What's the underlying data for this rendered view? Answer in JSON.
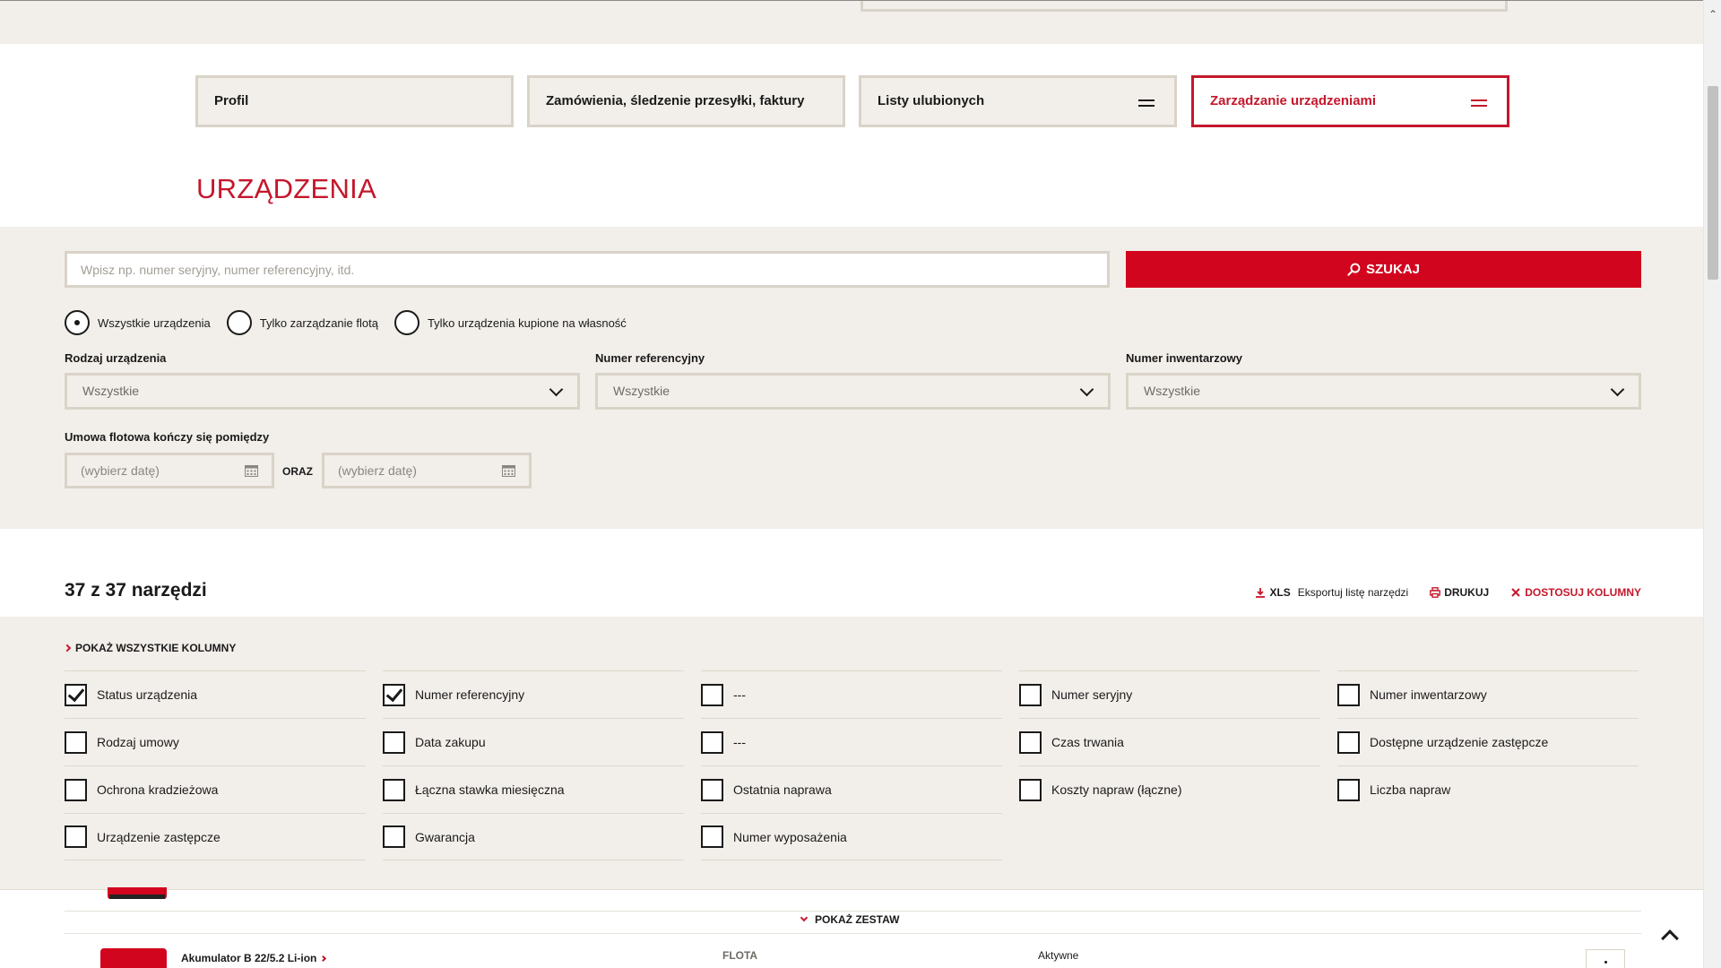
{
  "nav": {
    "tabs": [
      {
        "label": "Profil"
      },
      {
        "label": "Zamówienia, śledzenie przesyłki, faktury"
      },
      {
        "label": "Listy ulubionych"
      },
      {
        "label": "Zarządzanie urządzeniami"
      }
    ],
    "active_index": 3
  },
  "page_title": "URZĄDZENIA",
  "search": {
    "placeholder": "Wpisz np. numer seryjny, numer referencyjny, itd.",
    "value": "",
    "button_label": "SZUKAJ"
  },
  "radio_options": [
    {
      "label": "Wszystkie urządzenia",
      "checked": true
    },
    {
      "label": "Tylko zarządzanie flotą",
      "checked": false
    },
    {
      "label": "Tylko urządzenia kupione na własność",
      "checked": false
    }
  ],
  "filters": {
    "device_type": {
      "label": "Rodzaj urządzenia",
      "value": "Wszystkie"
    },
    "reference_number": {
      "label": "Numer referencyjny",
      "value": "Wszystkie"
    },
    "inventory_number": {
      "label": "Numer inwentarzowy",
      "value": "Wszystkie"
    }
  },
  "date_range": {
    "label": "Umowa flotowa kończy się pomiędzy",
    "from_placeholder": "(wybierz datę)",
    "joiner": "ORAZ",
    "to_placeholder": "(wybierz datę)"
  },
  "results": {
    "count_text": "37 z 37 narzędzi"
  },
  "toolbar": {
    "xls_label": "XLS",
    "export_label": "Eksportuj listę narzędzi",
    "print_label": "DRUKUJ",
    "customize_label": "DOSTOSUJ KOLUMNY"
  },
  "columns_panel": {
    "show_all_label": "POKAŻ WSZYSTKIE KOLUMNY",
    "items": [
      {
        "label": "Status urządzenia",
        "checked": true
      },
      {
        "label": "Numer referencyjny",
        "checked": true
      },
      {
        "label": "---",
        "checked": false
      },
      {
        "label": "Numer seryjny",
        "checked": false
      },
      {
        "label": "Numer inwentarzowy",
        "checked": false
      },
      {
        "label": "Rodzaj umowy",
        "checked": false
      },
      {
        "label": "Data zakupu",
        "checked": false
      },
      {
        "label": "---",
        "checked": false
      },
      {
        "label": "Czas trwania",
        "checked": false
      },
      {
        "label": "Dostępne urządzenie zastępcze",
        "checked": false
      },
      {
        "label": "Ochrona kradzieżowa",
        "checked": false
      },
      {
        "label": "Łączna stawka miesięczna",
        "checked": false
      },
      {
        "label": "Ostatnia naprawa",
        "checked": false
      },
      {
        "label": "Koszty napraw (łączne)",
        "checked": false
      },
      {
        "label": "Liczba napraw",
        "checked": false
      },
      {
        "label": "Urządzenie zastępcze",
        "checked": false
      },
      {
        "label": "Gwarancja",
        "checked": false
      },
      {
        "label": "Numer wyposażenia",
        "checked": false
      }
    ]
  },
  "product_list": {
    "show_set_label": "POKAŻ ZESTAW",
    "row": {
      "name": "Akumulator B 22/5.2 Li-ion",
      "type": "FLOTA",
      "status": "Aktywne"
    }
  },
  "colors": {
    "brand_red": "#d2051e",
    "accent_red": "#c4172c",
    "panel_bg": "#f2efea",
    "border": "#d9d3c8"
  }
}
